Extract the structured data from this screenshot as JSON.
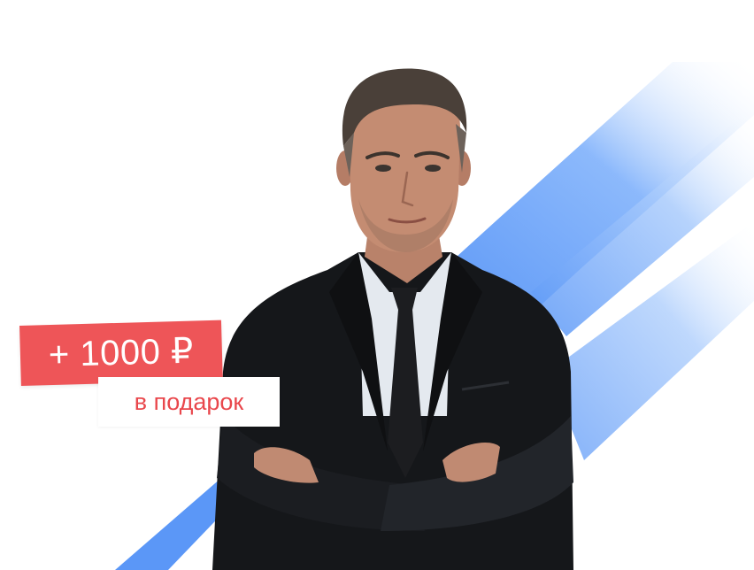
{
  "promo": {
    "amount_label": "+ 1000 ₽",
    "gift_label": "в подарок"
  },
  "colors": {
    "badge_red": "#ee5558",
    "gift_text": "#e9474c",
    "stripe_blue": "#5b97f7",
    "suit": "#15171a",
    "shirt": "#e4e9ef"
  },
  "image": {
    "subject": "man-in-suit-arms-crossed"
  }
}
